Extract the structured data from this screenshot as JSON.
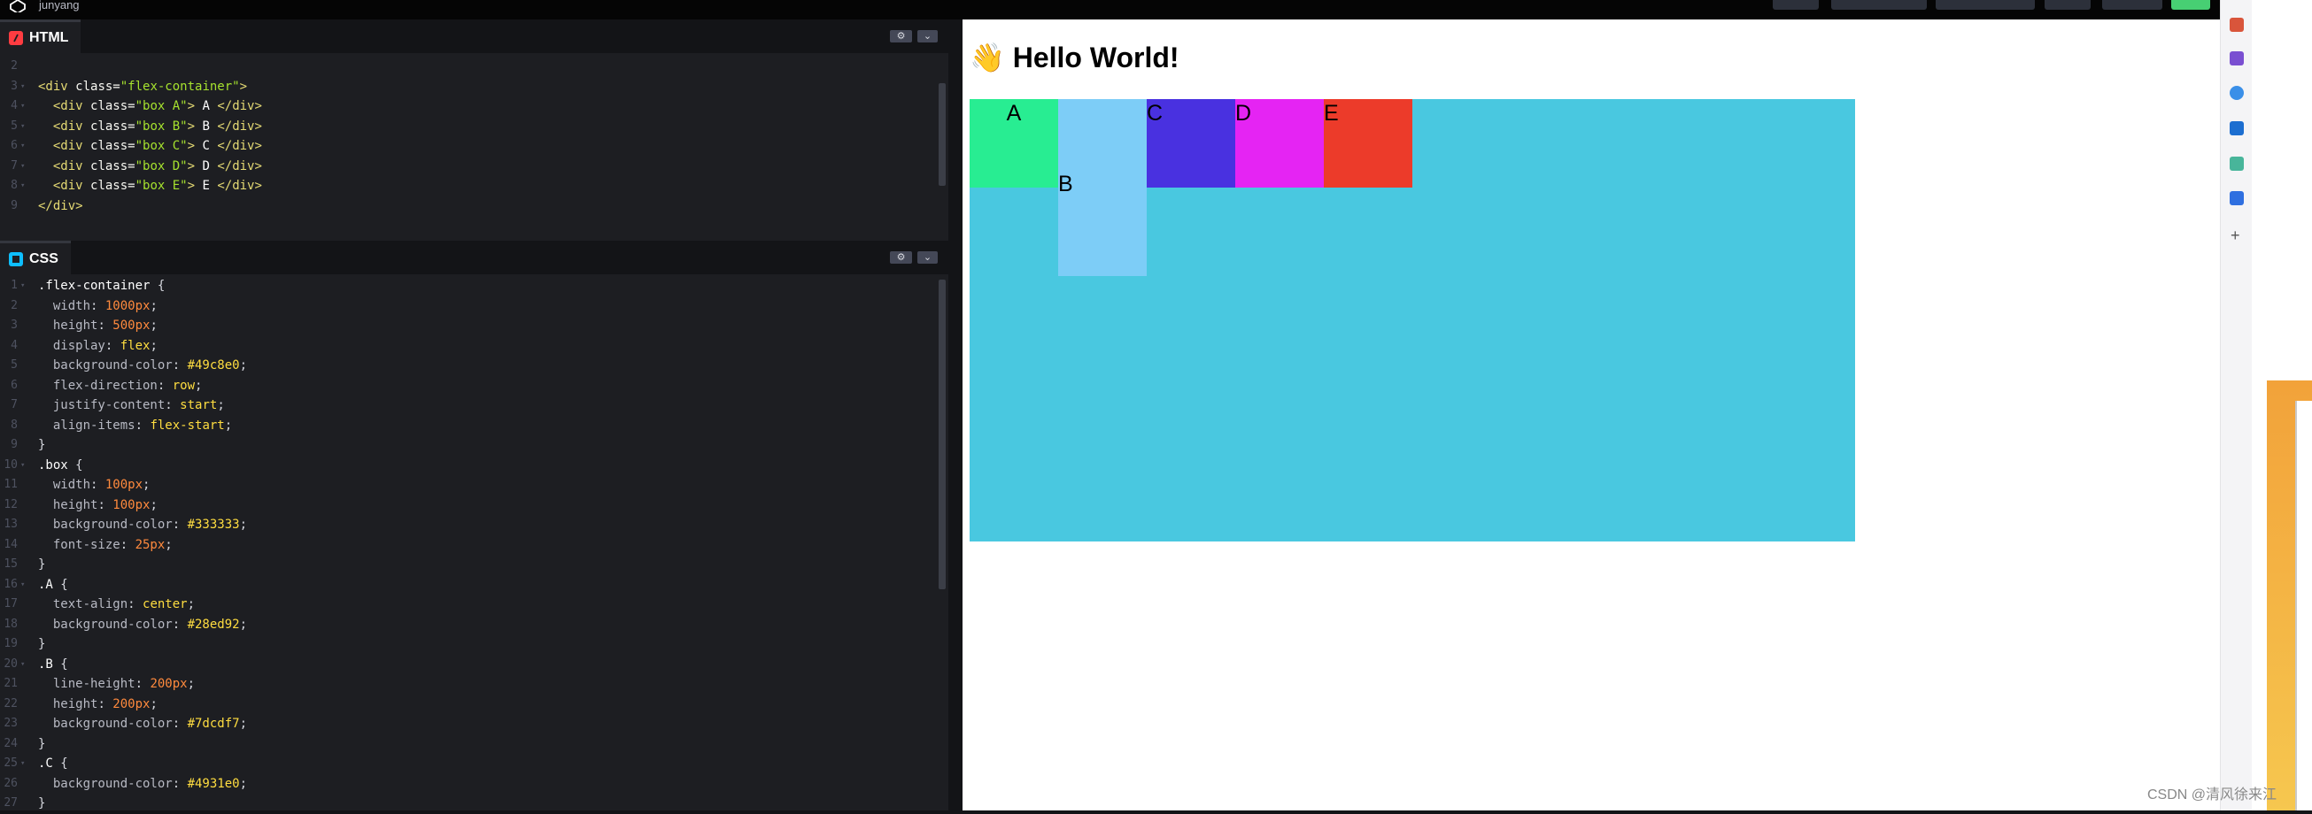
{
  "topbar": {
    "user": "junyang"
  },
  "html_panel": {
    "label": "HTML",
    "lines": [
      {
        "n": "2",
        "fold": "",
        "segs": []
      },
      {
        "n": "3",
        "fold": "▾",
        "segs": [
          [
            "t-tag",
            "<div "
          ],
          [
            "t-attr",
            "class="
          ],
          [
            "t-str",
            "\"flex-container\""
          ],
          [
            "t-tag",
            ">"
          ]
        ]
      },
      {
        "n": "4",
        "fold": "▾",
        "segs": [
          [
            "t-pun",
            "  "
          ],
          [
            "t-tag",
            "<div "
          ],
          [
            "t-attr",
            "class="
          ],
          [
            "t-str",
            "\"box A\""
          ],
          [
            "t-tag",
            "> "
          ],
          [
            "t-sel",
            "A"
          ],
          [
            "t-tag",
            " </div>"
          ]
        ]
      },
      {
        "n": "5",
        "fold": "▾",
        "segs": [
          [
            "t-pun",
            "  "
          ],
          [
            "t-tag",
            "<div "
          ],
          [
            "t-attr",
            "class="
          ],
          [
            "t-str",
            "\"box B\""
          ],
          [
            "t-tag",
            "> "
          ],
          [
            "t-sel",
            "B"
          ],
          [
            "t-tag",
            " </div>"
          ]
        ]
      },
      {
        "n": "6",
        "fold": "▾",
        "segs": [
          [
            "t-pun",
            "  "
          ],
          [
            "t-tag",
            "<div "
          ],
          [
            "t-attr",
            "class="
          ],
          [
            "t-str",
            "\"box C\""
          ],
          [
            "t-tag",
            "> "
          ],
          [
            "t-sel",
            "C"
          ],
          [
            "t-tag",
            " </div>"
          ]
        ]
      },
      {
        "n": "7",
        "fold": "▾",
        "segs": [
          [
            "t-pun",
            "  "
          ],
          [
            "t-tag",
            "<div "
          ],
          [
            "t-attr",
            "class="
          ],
          [
            "t-str",
            "\"box D\""
          ],
          [
            "t-tag",
            "> "
          ],
          [
            "t-sel",
            "D"
          ],
          [
            "t-tag",
            " </div>"
          ]
        ]
      },
      {
        "n": "8",
        "fold": "▾",
        "segs": [
          [
            "t-pun",
            "  "
          ],
          [
            "t-tag",
            "<div "
          ],
          [
            "t-attr",
            "class="
          ],
          [
            "t-str",
            "\"box E\""
          ],
          [
            "t-tag",
            "> "
          ],
          [
            "t-sel",
            "E"
          ],
          [
            "t-tag",
            " </div>"
          ]
        ]
      },
      {
        "n": "9",
        "fold": "",
        "segs": [
          [
            "t-tag",
            "</div>"
          ]
        ]
      }
    ]
  },
  "css_panel": {
    "label": "CSS",
    "lines": [
      {
        "n": "1",
        "fold": "▾",
        "segs": [
          [
            "t-sel",
            ".flex-container "
          ],
          [
            "t-pun",
            "{"
          ]
        ]
      },
      {
        "n": "2",
        "fold": "",
        "segs": [
          [
            "t-pun",
            "  "
          ],
          [
            "t-prop",
            "width"
          ],
          [
            "t-pun",
            ": "
          ],
          [
            "t-num",
            "1000px"
          ],
          [
            "t-pun",
            ";"
          ]
        ]
      },
      {
        "n": "3",
        "fold": "",
        "segs": [
          [
            "t-pun",
            "  "
          ],
          [
            "t-prop",
            "height"
          ],
          [
            "t-pun",
            ": "
          ],
          [
            "t-num",
            "500px"
          ],
          [
            "t-pun",
            ";"
          ]
        ]
      },
      {
        "n": "4",
        "fold": "",
        "segs": [
          [
            "t-pun",
            "  "
          ],
          [
            "t-prop",
            "display"
          ],
          [
            "t-pun",
            ": "
          ],
          [
            "t-val",
            "flex"
          ],
          [
            "t-pun",
            ";"
          ]
        ]
      },
      {
        "n": "5",
        "fold": "",
        "segs": [
          [
            "t-pun",
            "  "
          ],
          [
            "t-prop",
            "background-color"
          ],
          [
            "t-pun",
            ": "
          ],
          [
            "t-val",
            "#49c8e0"
          ],
          [
            "t-pun",
            ";"
          ]
        ]
      },
      {
        "n": "6",
        "fold": "",
        "segs": [
          [
            "t-pun",
            "  "
          ],
          [
            "t-prop",
            "flex-direction"
          ],
          [
            "t-pun",
            ": "
          ],
          [
            "t-val",
            "row"
          ],
          [
            "t-pun",
            ";"
          ]
        ]
      },
      {
        "n": "7",
        "fold": "",
        "segs": [
          [
            "t-pun",
            "  "
          ],
          [
            "t-prop",
            "justify-content"
          ],
          [
            "t-pun",
            ": "
          ],
          [
            "t-val",
            "start"
          ],
          [
            "t-pun",
            ";"
          ]
        ]
      },
      {
        "n": "8",
        "fold": "",
        "segs": [
          [
            "t-pun",
            "  "
          ],
          [
            "t-prop",
            "align-items"
          ],
          [
            "t-pun",
            ": "
          ],
          [
            "t-val",
            "flex-start"
          ],
          [
            "t-pun",
            ";"
          ]
        ]
      },
      {
        "n": "9",
        "fold": "",
        "segs": [
          [
            "t-pun",
            "}"
          ]
        ]
      },
      {
        "n": "10",
        "fold": "▾",
        "segs": [
          [
            "t-sel",
            ".box "
          ],
          [
            "t-pun",
            "{"
          ]
        ]
      },
      {
        "n": "11",
        "fold": "",
        "segs": [
          [
            "t-pun",
            "  "
          ],
          [
            "t-prop",
            "width"
          ],
          [
            "t-pun",
            ": "
          ],
          [
            "t-num",
            "100px"
          ],
          [
            "t-pun",
            ";"
          ]
        ]
      },
      {
        "n": "12",
        "fold": "",
        "segs": [
          [
            "t-pun",
            "  "
          ],
          [
            "t-prop",
            "height"
          ],
          [
            "t-pun",
            ": "
          ],
          [
            "t-num",
            "100px"
          ],
          [
            "t-pun",
            ";"
          ]
        ]
      },
      {
        "n": "13",
        "fold": "",
        "segs": [
          [
            "t-pun",
            "  "
          ],
          [
            "t-prop",
            "background-color"
          ],
          [
            "t-pun",
            ": "
          ],
          [
            "t-val",
            "#333333"
          ],
          [
            "t-pun",
            ";"
          ]
        ]
      },
      {
        "n": "14",
        "fold": "",
        "segs": [
          [
            "t-pun",
            "  "
          ],
          [
            "t-prop",
            "font-size"
          ],
          [
            "t-pun",
            ": "
          ],
          [
            "t-num",
            "25px"
          ],
          [
            "t-pun",
            ";"
          ]
        ]
      },
      {
        "n": "15",
        "fold": "",
        "segs": [
          [
            "t-pun",
            "}"
          ]
        ]
      },
      {
        "n": "16",
        "fold": "▾",
        "segs": [
          [
            "t-sel",
            ".A "
          ],
          [
            "t-pun",
            "{"
          ]
        ]
      },
      {
        "n": "17",
        "fold": "",
        "segs": [
          [
            "t-pun",
            "  "
          ],
          [
            "t-prop",
            "text-align"
          ],
          [
            "t-pun",
            ": "
          ],
          [
            "t-val",
            "center"
          ],
          [
            "t-pun",
            ";"
          ]
        ]
      },
      {
        "n": "18",
        "fold": "",
        "segs": [
          [
            "t-pun",
            "  "
          ],
          [
            "t-prop",
            "background-color"
          ],
          [
            "t-pun",
            ": "
          ],
          [
            "t-val",
            "#28ed92"
          ],
          [
            "t-pun",
            ";"
          ]
        ]
      },
      {
        "n": "19",
        "fold": "",
        "segs": [
          [
            "t-pun",
            "}"
          ]
        ]
      },
      {
        "n": "20",
        "fold": "▾",
        "segs": [
          [
            "t-sel",
            ".B "
          ],
          [
            "t-pun",
            "{"
          ]
        ]
      },
      {
        "n": "21",
        "fold": "",
        "segs": [
          [
            "t-pun",
            "  "
          ],
          [
            "t-prop",
            "line-height"
          ],
          [
            "t-pun",
            ": "
          ],
          [
            "t-num",
            "200px"
          ],
          [
            "t-pun",
            ";"
          ]
        ]
      },
      {
        "n": "22",
        "fold": "",
        "segs": [
          [
            "t-pun",
            "  "
          ],
          [
            "t-prop",
            "height"
          ],
          [
            "t-pun",
            ": "
          ],
          [
            "t-num",
            "200px"
          ],
          [
            "t-pun",
            ";"
          ]
        ]
      },
      {
        "n": "23",
        "fold": "",
        "segs": [
          [
            "t-pun",
            "  "
          ],
          [
            "t-prop",
            "background-color"
          ],
          [
            "t-pun",
            ": "
          ],
          [
            "t-val",
            "#7dcdf7"
          ],
          [
            "t-pun",
            ";"
          ]
        ]
      },
      {
        "n": "24",
        "fold": "",
        "segs": [
          [
            "t-pun",
            "}"
          ]
        ]
      },
      {
        "n": "25",
        "fold": "▾",
        "segs": [
          [
            "t-sel",
            ".C "
          ],
          [
            "t-pun",
            "{"
          ]
        ]
      },
      {
        "n": "26",
        "fold": "",
        "segs": [
          [
            "t-pun",
            "  "
          ],
          [
            "t-prop",
            "background-color"
          ],
          [
            "t-pun",
            ": "
          ],
          [
            "t-val",
            "#4931e0"
          ],
          [
            "t-pun",
            ";"
          ]
        ]
      },
      {
        "n": "27",
        "fold": "",
        "segs": [
          [
            "t-pun",
            "}"
          ]
        ]
      }
    ]
  },
  "preview": {
    "emoji": "👋",
    "title": "Hello World!",
    "container_color": "#49c8e0",
    "boxes": [
      {
        "label": "A",
        "color": "#28ed92"
      },
      {
        "label": "B",
        "color": "#7dcdf7"
      },
      {
        "label": "C",
        "color": "#4931e0"
      },
      {
        "label": "D",
        "color": "#e524f3"
      },
      {
        "label": "E",
        "color": "#ec3b2a"
      }
    ]
  },
  "icons": {
    "panel_settings": "gear-icon",
    "panel_collapse": "chevron-down-icon"
  },
  "watermark": "CSDN @清风徐来江"
}
